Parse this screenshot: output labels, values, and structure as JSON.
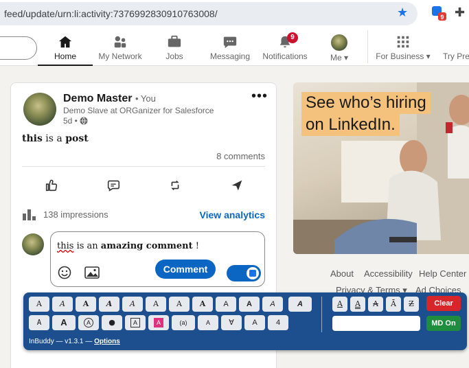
{
  "browser": {
    "url": "feed/update/urn:li:activity:7376992830910763008/",
    "extension_badge": "9"
  },
  "nav": {
    "items": [
      {
        "label": "Home"
      },
      {
        "label": "My Network"
      },
      {
        "label": "Jobs"
      },
      {
        "label": "Messaging"
      },
      {
        "label": "Notifications"
      },
      {
        "label": "Me"
      }
    ],
    "notification_badge": "9",
    "for_business": "For Business",
    "try_premium": "Try Pre"
  },
  "post": {
    "author": "Demo Master",
    "you_label": "• You",
    "subtitle": "Demo Slave at ORGanizer for Salesforce",
    "age": "5d •",
    "body_bold": "this",
    "body_mid": " is a ",
    "body_bold2": "post",
    "comments": "8 comments",
    "impressions": "138 impressions",
    "analytics": "View analytics",
    "comment_text_pre": "this",
    "comment_text_mid": " is an ",
    "comment_text_bold": "amazing comment",
    "comment_text_post": " !",
    "comment_button": "Comment"
  },
  "ad": {
    "line1": "See who’s hiring",
    "line2": "on LinkedIn."
  },
  "footer": {
    "about": "About",
    "accessibility": "Accessibility",
    "help": "Help Center",
    "privacy": "Privacy & Terms",
    "adchoices": "Ad Choices"
  },
  "inbuddy": {
    "row1": [
      "A",
      "A",
      "A",
      "A",
      "A",
      "A",
      "A",
      "A",
      "A",
      "A",
      "A",
      "A"
    ],
    "row2": [
      "A",
      "A",
      "A",
      "●",
      "A",
      "A",
      "(a)",
      "A",
      "∀",
      "A",
      "4"
    ],
    "right_row": [
      "A",
      "A",
      "A",
      "Ā",
      "Z"
    ],
    "clear": "Clear",
    "md_on": "MD On",
    "version": "InBuddy — v1.3.1 —",
    "options": "Options"
  }
}
